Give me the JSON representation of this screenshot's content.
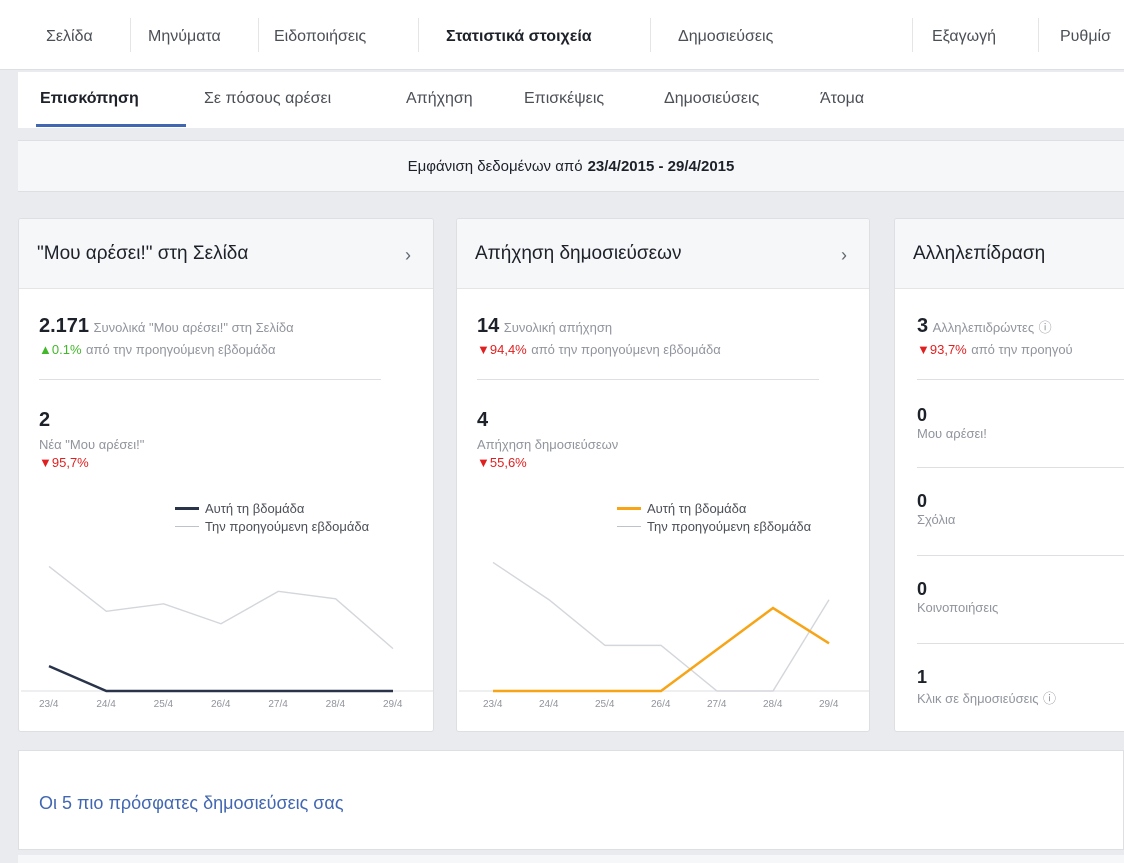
{
  "topnav": {
    "tabs": [
      "Σελίδα",
      "Μηνύματα",
      "Ειδοποιήσεις",
      "Στατιστικά στοιχεία",
      "Δημοσιεύσεις",
      "Εξαγωγή",
      "Ρυθμίσ"
    ]
  },
  "subnav": {
    "tabs": [
      "Επισκόπηση",
      "Σε πόσους αρέσει",
      "Απήχηση",
      "Επισκέψεις",
      "Δημοσιεύσεις",
      "Άτομα"
    ]
  },
  "datebar": {
    "prefix": "Εμφάνιση δεδομένων από",
    "range": "23/4/2015 - 29/4/2015"
  },
  "likes_card": {
    "title": "\"Μου αρέσει!\" στη Σελίδα",
    "total_value": "2.171",
    "total_label": "Συνολικά \"Μου αρέσει!\" στη Σελίδα",
    "total_change": "▲0.1%",
    "total_change_suffix": "από την προηγούμενη εβδομάδα",
    "new_value": "2",
    "new_label": "Νέα \"Μου αρέσει!\"",
    "new_change": "▼95,7%",
    "legend_this": "Αυτή τη βδομάδα",
    "legend_prev": "Την προηγούμενη εβδομάδα",
    "this_color": "#29344a",
    "prev_color": "#d3d6db"
  },
  "reach_card": {
    "title": "Απήχηση δημοσιεύσεων",
    "total_value": "14",
    "total_label": "Συνολική απήχηση",
    "total_change": "▼94,4%",
    "total_change_suffix": "από την προηγούμενη εβδομάδα",
    "new_value": "4",
    "new_label": "Απήχηση δημοσιεύσεων",
    "new_change": "▼55,6%",
    "legend_this": "Αυτή τη βδομάδα",
    "legend_prev": "Την προηγούμενη εβδομάδα",
    "this_color": "#f7a416",
    "prev_color": "#d3d6db"
  },
  "engagement_card": {
    "title": "Αλληλεπίδραση",
    "total_value": "3",
    "total_label": "Αλληλεπιδρώντες",
    "total_change": "▼93,7%",
    "total_change_suffix": "από την προηγού",
    "items": [
      {
        "value": "0",
        "label": "Μου αρέσει!"
      },
      {
        "value": "0",
        "label": "Σχόλια"
      },
      {
        "value": "0",
        "label": "Κοινοποιήσεις"
      },
      {
        "value": "1",
        "label": "Κλικ σε δημοσιεύσεις"
      }
    ]
  },
  "x_ticks": [
    "23/4",
    "24/4",
    "25/4",
    "26/4",
    "27/4",
    "28/4",
    "29/4"
  ],
  "recent": {
    "label": "Οι 5 πιο πρόσφατες δημοσιεύσεις σας"
  },
  "chart_data": [
    {
      "type": "line",
      "x": [
        "23/4",
        "24/4",
        "25/4",
        "26/4",
        "27/4",
        "28/4",
        "29/4"
      ],
      "series": [
        {
          "name": "Αυτή τη βδομάδα",
          "values": [
            2,
            0,
            0,
            0,
            0,
            0,
            0
          ]
        },
        {
          "name": "Την προηγούμενη εβδομάδα",
          "values": [
            10,
            6.4,
            7,
            5.4,
            8,
            7.4,
            3.4
          ]
        }
      ]
    },
    {
      "type": "line",
      "x": [
        "23/4",
        "24/4",
        "25/4",
        "26/4",
        "27/4",
        "28/4",
        "29/4"
      ],
      "series": [
        {
          "name": "Αυτή τη βδομάδα",
          "values": [
            0,
            0,
            0,
            0,
            2,
            4,
            2.3
          ]
        },
        {
          "name": "Την προηγούμενη εβδομάδα",
          "values": [
            6.2,
            4.4,
            2.2,
            2.2,
            0,
            0,
            4.4
          ]
        }
      ]
    }
  ]
}
